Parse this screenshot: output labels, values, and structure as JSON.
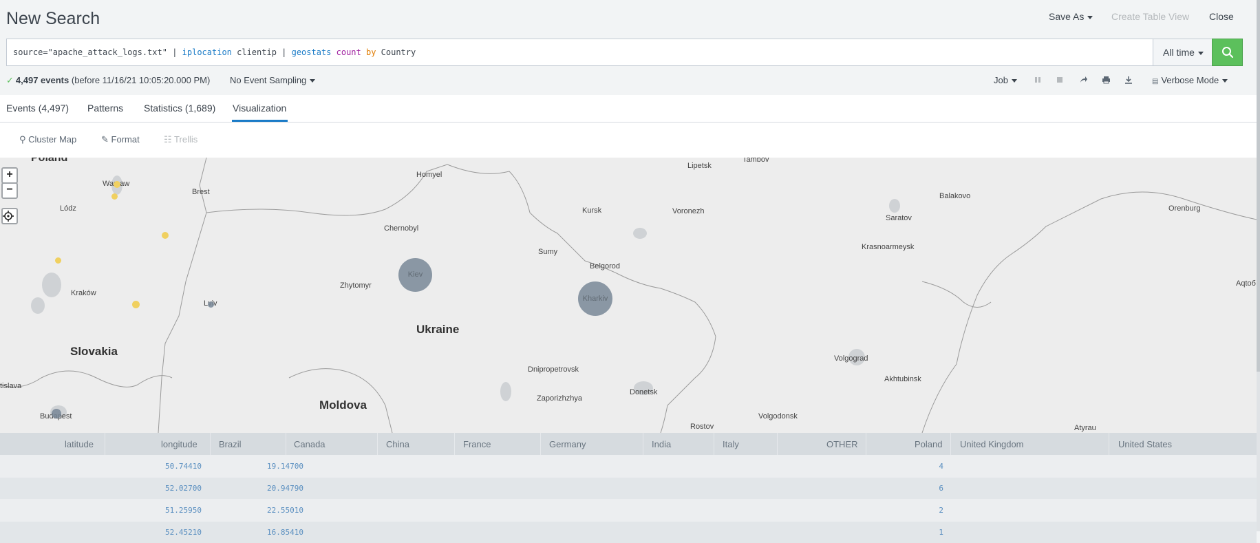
{
  "header": {
    "title": "New Search",
    "save_as": "Save As",
    "create_table_view": "Create Table View",
    "close": "Close"
  },
  "search": {
    "q_source": "source=\"apache_attack_logs.txt\" | ",
    "q_iplocation": "iplocation",
    "q_clientip": " clientip | ",
    "q_geostats": "geostats",
    "q_space1": " ",
    "q_count": "count",
    "q_space2": " ",
    "q_by": "by",
    "q_country": " Country",
    "time_range": "All time"
  },
  "status": {
    "events_count": "4,497 events",
    "events_before": "(before 11/16/21 10:05:20.000 PM)",
    "sampling": "No Event Sampling",
    "job": "Job",
    "mode": "Verbose Mode"
  },
  "tabs": [
    {
      "label": "Events (4,497)"
    },
    {
      "label": "Patterns"
    },
    {
      "label": "Statistics (1,689)"
    },
    {
      "label": "Visualization"
    }
  ],
  "viz_toolbar": {
    "cluster_map": "Cluster Map",
    "format": "Format",
    "trellis": "Trellis"
  },
  "map": {
    "labels": {
      "poland": "Poland",
      "warsaw": "Warsaw",
      "brest": "Brest",
      "lodz": "Lódz",
      "krakow": "Kraków",
      "lviv": "Lviv",
      "slovakia": "Slovakia",
      "bratislava": "tislava",
      "budapest": "Budapest",
      "homyel": "Homyel",
      "chernobyl": "Chernobyl",
      "zhytomyr": "Zhytomyr",
      "kiev": "Kiev",
      "ukraine": "Ukraine",
      "moldova": "Moldova",
      "lipetsk": "Lipetsk",
      "tambov": "Tambov",
      "kursk": "Kursk",
      "voronezh": "Voronezh",
      "sumy": "Sumy",
      "belgorod": "Belgorod",
      "kharkiv": "Kharkiv",
      "dnipro": "Dnipropetrovsk",
      "zaporizhzhya": "Zaporizhzhya",
      "donetsk": "Donetsk",
      "rostov": "Rostov",
      "volgodonsk": "Volgodonsk",
      "volgograd": "Volgograd",
      "akhtubinsk": "Akhtubinsk",
      "saratov": "Saratov",
      "balakovo": "Balakovo",
      "krasnoarmeysk": "Krasnoarmeysk",
      "orenburg": "Orenburg",
      "aqtobe": "Aqtoб",
      "atyrau": "Atyrau"
    }
  },
  "table": {
    "headers": [
      "latitude",
      "longitude",
      "Brazil",
      "Canada",
      "China",
      "France",
      "Germany",
      "India",
      "Italy",
      "OTHER",
      "Poland",
      "United Kingdom",
      "United States"
    ],
    "rows": [
      {
        "latitude": "50.74410",
        "longitude": "19.14700",
        "poland": "4"
      },
      {
        "latitude": "52.02700",
        "longitude": "20.94790",
        "poland": "6"
      },
      {
        "latitude": "51.25950",
        "longitude": "22.55010",
        "poland": "2"
      },
      {
        "latitude": "52.45210",
        "longitude": "16.85410",
        "poland": "1"
      }
    ]
  }
}
